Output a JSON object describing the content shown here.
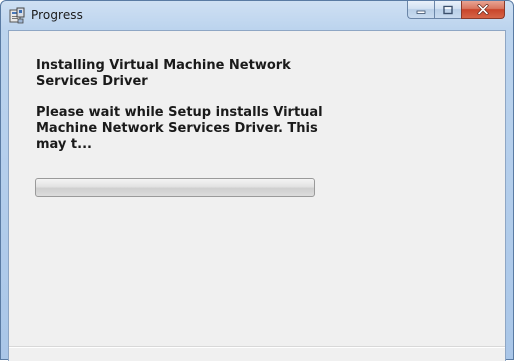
{
  "window": {
    "title": "Progress",
    "icon": "setup-installer-icon",
    "caption_buttons": {
      "minimize": "minimize-icon",
      "maximize": "maximize-icon",
      "close": "close-icon"
    }
  },
  "content": {
    "heading": "Installing Virtual Machine Network Services Driver",
    "description": "Please wait while Setup installs Virtual Machine Network Services Driver. This may t..."
  },
  "progress": {
    "value_percent": 0
  },
  "colors": {
    "client_background": "#f0f0f0",
    "titlebar": "#bcd4ee",
    "close_button": "#c8442a"
  }
}
